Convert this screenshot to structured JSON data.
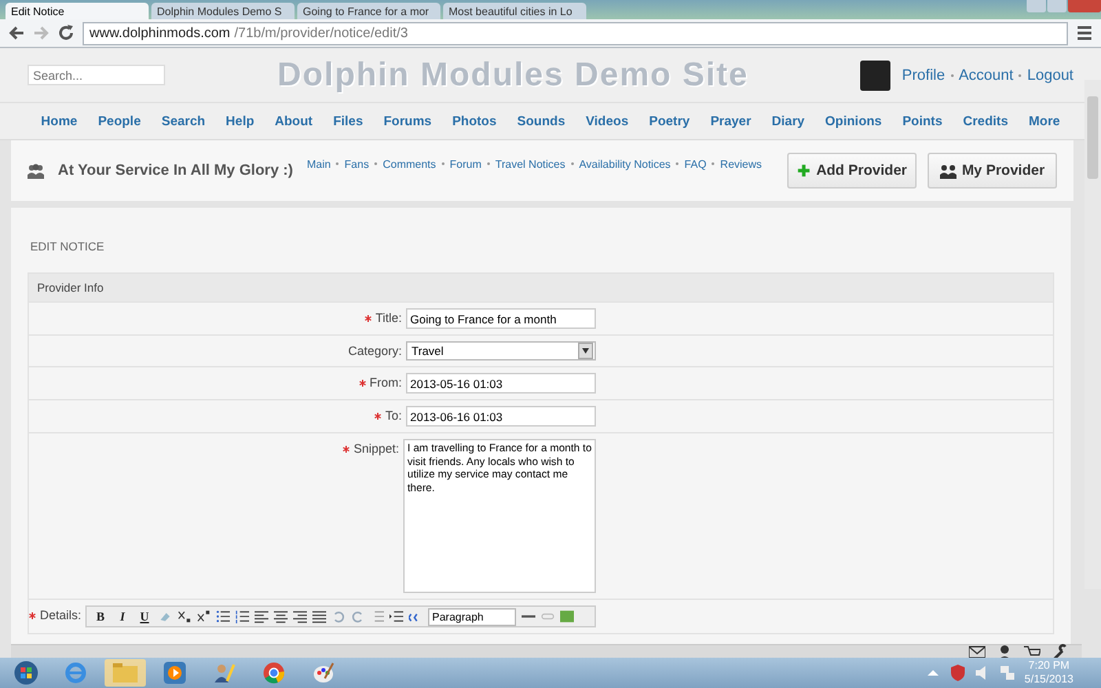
{
  "browser": {
    "tabs": [
      {
        "label": "Edit Notice",
        "selected": true
      },
      {
        "label": "Dolphin Modules Demo S",
        "selected": false
      },
      {
        "label": "Going to France for a mor",
        "selected": false
      },
      {
        "label": "Most beautiful cities in Lo",
        "selected": false
      }
    ],
    "url_host": "www.dolphinmods.com",
    "url_path": "/71b/m/provider/notice/edit/3"
  },
  "header": {
    "search": {
      "placeholder": "Search..."
    },
    "site_title": "Dolphin Modules Demo Site",
    "user_links": [
      "Profile",
      "Account",
      "Logout"
    ]
  },
  "nav": [
    "Home",
    "People",
    "Search",
    "Help",
    "About",
    "Files",
    "Forums",
    "Photos",
    "Sounds",
    "Videos",
    "Poetry",
    "Prayer",
    "Diary",
    "Opinions",
    "Points",
    "Credits",
    "More"
  ],
  "subheader": {
    "title": "At Your Service In All My Glory :)",
    "links": [
      "Main",
      "Fans",
      "Comments",
      "Forum",
      "Travel Notices",
      "Availability Notices",
      "FAQ",
      "Reviews"
    ],
    "buttons": [
      {
        "label": "Add Provider",
        "kind": "add"
      },
      {
        "label": "My Provider",
        "kind": "group"
      }
    ]
  },
  "page_title": "EDIT NOTICE",
  "section": "Provider Info",
  "fields": [
    {
      "label": "Title:",
      "required": true,
      "kind": "text",
      "value": "Going to France for a month"
    },
    {
      "label": "Category:",
      "required": false,
      "kind": "select",
      "value": "Travel"
    },
    {
      "label": "From:",
      "required": true,
      "kind": "text",
      "value": "2013-05-16 01:03"
    },
    {
      "label": "To:",
      "required": true,
      "kind": "text",
      "value": "2013-06-16 01:03"
    },
    {
      "label": "Snippet:",
      "required": true,
      "kind": "textarea",
      "value": "I am travelling to France for a month to visit friends. Any locals who wish to utilize my service may contact me there."
    },
    {
      "label": "Details:",
      "required": true,
      "kind": "editor",
      "buttons": [
        "B",
        "I",
        "U"
      ],
      "format": "Paragraph"
    }
  ],
  "taskbar": {
    "time": "7:20 PM",
    "date": "5/15/2013"
  }
}
